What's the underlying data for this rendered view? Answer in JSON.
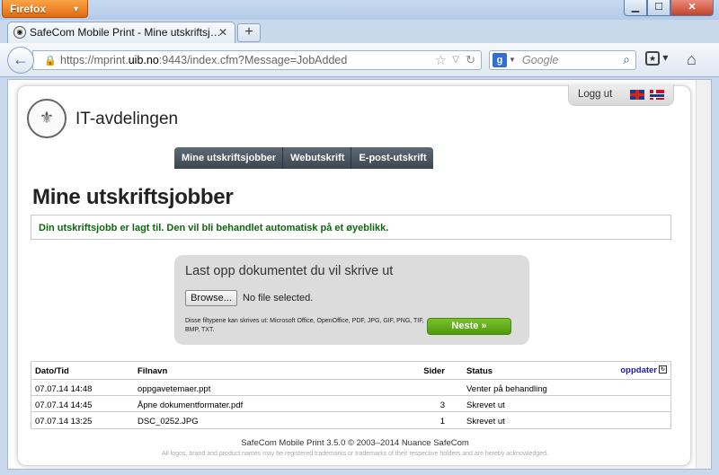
{
  "browser": {
    "app_button": "Firefox",
    "tab_title": "SafeCom Mobile Print - Mine utskriftsj…",
    "url_prefix": "https://mprint.",
    "url_host": "uib.no",
    "url_suffix": ":9443/index.cfm?Message=JobAdded",
    "search_placeholder": "Google"
  },
  "header": {
    "logout": "Logg ut",
    "org_title": "IT-avdelingen"
  },
  "menu": {
    "items": [
      "Mine utskriftsjobber",
      "Webutskrift",
      "E-post-utskrift"
    ]
  },
  "main": {
    "heading": "Mine utskriftsjobber",
    "message": "Din utskriftsjobb er lagt til. Den vil bli behandlet automatisk på et øyeblikk."
  },
  "upload": {
    "title": "Last opp dokumentet du vil skrive ut",
    "browse_label": "Browse...",
    "file_status": "No file selected.",
    "file_types": "Disse filtypene kan skrives ut: Microsoft Office, OpenOffice, PDF, JPG, GIF, PNG, TIF, BMP, TXT.",
    "next_label": "Neste »"
  },
  "jobs": {
    "headers": {
      "date": "Dato/Tid",
      "file": "Filnavn",
      "pages": "Sider",
      "status": "Status",
      "refresh": "oppdater"
    },
    "rows": [
      {
        "date": "07.07.14 14:48",
        "file": "oppgavetemaer.ppt",
        "pages": "",
        "status": "Venter på behandling"
      },
      {
        "date": "07.07.14 14:45",
        "file": "Åpne dokumentformater.pdf",
        "pages": "3",
        "status": "Skrevet ut"
      },
      {
        "date": "07.07.14 13:25",
        "file": "DSC_0252.JPG",
        "pages": "1",
        "status": "Skrevet ut"
      }
    ]
  },
  "footer": {
    "main": "SafeCom Mobile Print 3.5.0 © 2003–2014 Nuance SafeCom",
    "sub": "All logos, brand and product names may be registered trademarks or trademarks of their respective holders and are hereby acknowledged."
  },
  "colors": {
    "menu_bg": "#4a555f",
    "message_text": "#0a6a0a",
    "next_button": "#5aa818"
  }
}
